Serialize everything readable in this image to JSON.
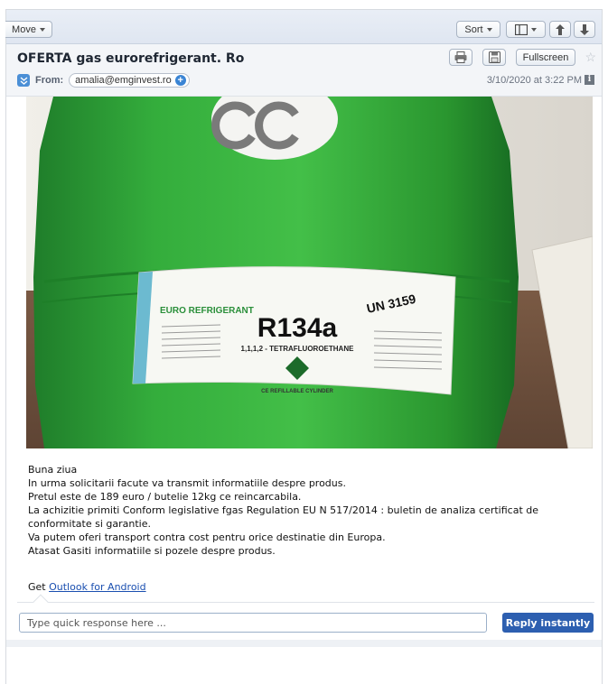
{
  "toolbar": {
    "move_label": "Move",
    "sort_label": "Sort"
  },
  "header": {
    "subject": "OFERTA gas eurorefrigerant. Ro",
    "from_label": "From:",
    "from_email": "amalia@emginvest.ro",
    "fullscreen_label": "Fullscreen",
    "date": "3/10/2020 at 3:22 PM"
  },
  "photo": {
    "product_name": "R134a",
    "un_number": "UN 3159",
    "chemical": "1,1,1,2 - TETRAFLUOROETHANE",
    "brand": "EURO REFRIGERANT",
    "cylinder_note": "CE REFILLABLE CYLINDER"
  },
  "message": {
    "lines": [
      "Buna ziua",
      "In urma solicitarii facute va transmit informatiile despre produs.",
      "Pretul este de 189 euro / butelie 12kg ce reincarcabila.",
      "La achizitie primiti Conform legislative fgas Regulation EU N 517/2014 : buletin de analiza certificat de conformitate si garantie.",
      "Va putem oferi transport contra cost pentru orice destinatie din Europa.",
      "Atasat Gasiti informatiile si pozele despre produs."
    ],
    "get_prefix": "Get",
    "get_link": "Outlook for Android"
  },
  "reply": {
    "placeholder": "Type quick response here ...",
    "button_label": "Reply instantly"
  },
  "colors": {
    "accent": "#2d5fb0",
    "cylinder_green": "#2fa336"
  }
}
